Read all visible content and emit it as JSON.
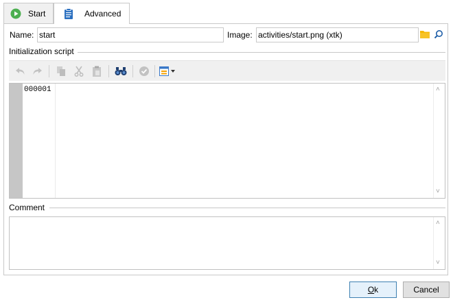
{
  "tabs": [
    {
      "label": "Start",
      "icon": "play-icon",
      "active": false
    },
    {
      "label": "Advanced",
      "icon": "clipboard-icon",
      "active": true
    }
  ],
  "form": {
    "name_label": "Name:",
    "name_value": "start",
    "image_label": "Image:",
    "image_value": "activities/start.png (xtk)"
  },
  "init_script": {
    "title": "Initialization script",
    "line_number": "000001",
    "content": ""
  },
  "toolbar": {
    "icons": [
      "undo-icon",
      "redo-icon",
      "copy-icon",
      "cut-icon",
      "paste-icon",
      "find-icon",
      "check-icon",
      "insert-menu-icon"
    ]
  },
  "comment": {
    "title": "Comment",
    "content": ""
  },
  "buttons": {
    "ok": "Ok",
    "ok_accel": "O",
    "ok_rest": "k",
    "cancel": "Cancel"
  },
  "colors": {
    "accent": "#3c7fb1",
    "play_green": "#4caf50",
    "folder_yellow": "#f5b800",
    "find_blue": "#1f5fa8"
  }
}
